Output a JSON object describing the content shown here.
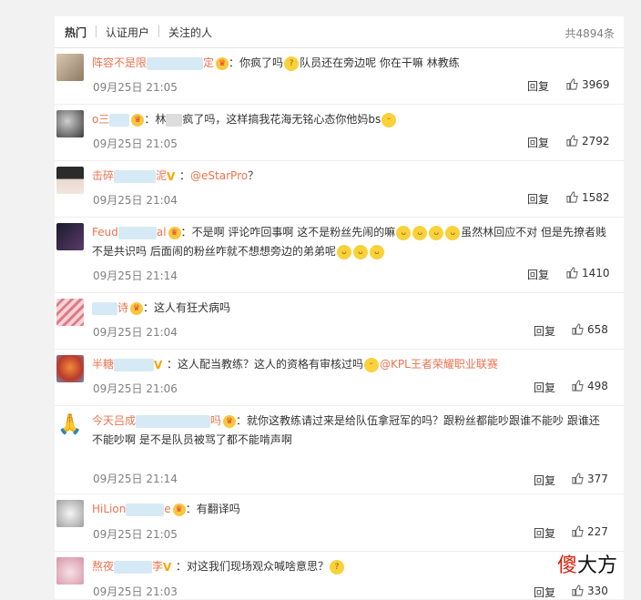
{
  "tabs": {
    "hot": "热门",
    "verified": "认证用户",
    "following": "关注的人",
    "total": "共4894条"
  },
  "reply_label": "回复",
  "colors": {
    "username": "#eb7350",
    "mention": "#eb7350",
    "text": "#333333",
    "meta": "#808080"
  },
  "comments": [
    {
      "name_start": "阵容不是限",
      "name_end": "定",
      "badge": "crown-badge",
      "text_before": "你疯了吗",
      "emoji_1": "惊讶",
      "text_after": "队员还在旁边呢 你在干嘛 林教练",
      "time": "09月25日 21:05",
      "likes": "3969"
    },
    {
      "name_start": "o三",
      "name_end": "",
      "badge": "crown-badge",
      "text_before": "林",
      "text_mid": "疯了吗，这样搞我花海无铭心态你他妈bs",
      "emoji_1": "笑",
      "time": "09月25日 21:05",
      "likes": "2792"
    },
    {
      "name_start": "击碎",
      "name_end": "泥",
      "badge": "v-badge",
      "mention": "@eStarPro",
      "text_after": "？",
      "time": "09月25日 21:04",
      "likes": "1582"
    },
    {
      "name_start": "Feud",
      "name_end": "al",
      "badge": "crown-badge",
      "text_line1_a": "不是啊 评论咋回事啊 这不是粉丝先闹的嘛",
      "text_line1_b": "虽然林回应不对 但是先撩者贱",
      "text_line2": "不是共识吗 后面闹的粉丝咋就不想想旁边的弟弟呢",
      "emoji_1": "笑哭",
      "time": "09月25日 21:14",
      "likes": "1410"
    },
    {
      "name_start": "",
      "name_end": "诗",
      "badge": "crown-badge",
      "text_before": "这人有狂犬病吗",
      "time": "09月25日 21:04",
      "likes": "658"
    },
    {
      "name_start": "半糖",
      "name_end": "",
      "badge": "v-badge",
      "text_before": "这人配当教练？这人的资格有审核过吗",
      "emoji_1": "笑",
      "mention": "@KPL王者荣耀职业联赛",
      "time": "09月25日 21:06",
      "likes": "498"
    },
    {
      "name_start": "今天吕成",
      "name_end": "吗",
      "badge": "crown-badge",
      "text_line1": "就你这教练请过来是给队伍拿冠军的吗？跟粉丝都能吵跟谁不能吵 跟谁还",
      "text_line2": "不能吵啊 是不是队员被骂了都不能啃声啊",
      "time": "09月25日 21:14",
      "likes": "377"
    },
    {
      "name_start": "HiLion",
      "name_end": "e",
      "badge": "crown-badge",
      "text_before": "有翻译吗",
      "time": "09月25日 21:05",
      "likes": "227"
    },
    {
      "name_start": "熬夜",
      "name_end": "李",
      "badge": "v-badge",
      "text_before": "对这我们现场观众喊啥意思？",
      "emoji_1": "疑问",
      "time": "09月25日 21:03",
      "likes": "330"
    }
  ],
  "watermark": {
    "char1": "傻",
    "rest": "大方"
  }
}
